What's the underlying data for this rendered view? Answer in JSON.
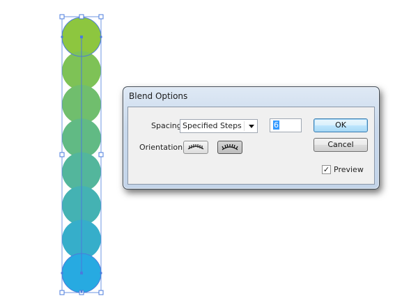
{
  "dialog": {
    "title": "Blend Options",
    "spacing_label": "Spacing:",
    "spacing_value": "Specified Steps",
    "steps_value": "6",
    "orientation_label": "Orientation:",
    "orientation_options": [
      "align-to-page-icon",
      "align-to-path-icon"
    ],
    "orientation_selected_index": 1,
    "ok_label": "OK",
    "cancel_label": "Cancel",
    "preview_label": "Preview",
    "preview_checked": true,
    "check_glyph": "✓"
  },
  "artboard": {
    "blend_steps": 6,
    "start_color": "#8dc63f",
    "end_color": "#27aae1",
    "selection_color": "#4a7bdc"
  }
}
